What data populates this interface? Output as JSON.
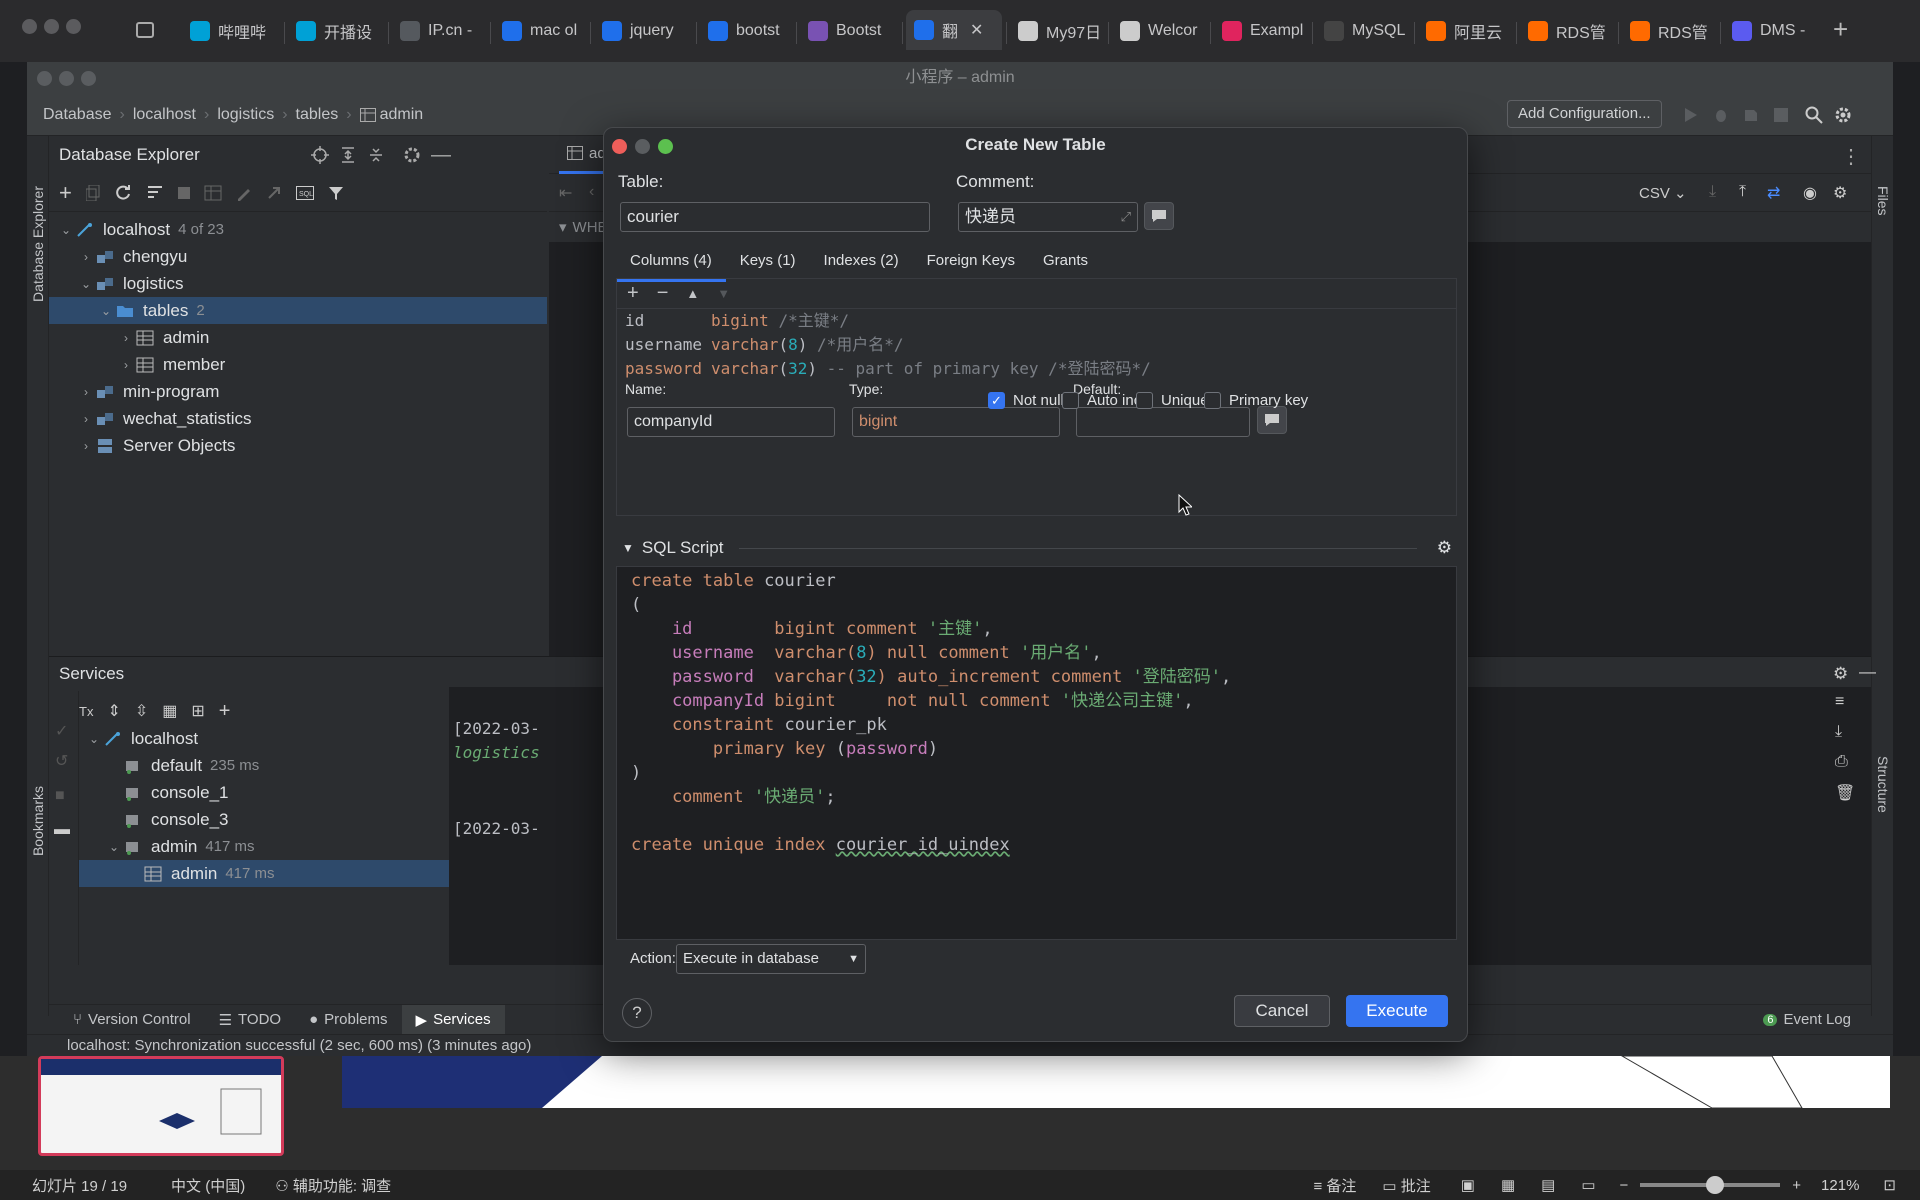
{
  "browser": {
    "tabs": [
      {
        "label": "哔哩哔",
        "fav": "bilibili-icon",
        "color": "#00a1d6"
      },
      {
        "label": "开播设",
        "fav": "bilibili-icon",
        "color": "#00a1d6"
      },
      {
        "label": "IP.cn -",
        "fav": "ip-icon",
        "color": "#55595e"
      },
      {
        "label": "mac ol",
        "fav": "bing-icon",
        "color": "#1f6feb"
      },
      {
        "label": "jquery",
        "fav": "bing-icon",
        "color": "#1f6feb"
      },
      {
        "label": "bootst",
        "fav": "bing-icon",
        "color": "#1f6feb"
      },
      {
        "label": "Bootst",
        "fav": "bootstrap-icon",
        "color": "#7952b3"
      },
      {
        "label": "翻",
        "fav": "bing-icon",
        "color": "#1f6feb",
        "active": true
      },
      {
        "label": "My97日",
        "fav": "page-icon",
        "color": "#cccccc"
      },
      {
        "label": "Welcor",
        "fav": "globe-icon",
        "color": "#cccccc"
      },
      {
        "label": "Exampl",
        "fav": "record-icon",
        "color": "#e0245e"
      },
      {
        "label": "MySQL",
        "fav": "b-icon",
        "color": "#444"
      },
      {
        "label": "阿里云",
        "fav": "aliyun-icon",
        "color": "#ff6a00"
      },
      {
        "label": "RDS管",
        "fav": "aliyun-icon",
        "color": "#ff6a00"
      },
      {
        "label": "RDS管",
        "fav": "aliyun-icon",
        "color": "#ff6a00"
      },
      {
        "label": "DMS -",
        "fav": "dms-icon",
        "color": "#5b5bf0"
      }
    ]
  },
  "ide": {
    "window_title": "小程序 – admin",
    "breadcrumb": [
      "Database",
      "localhost",
      "logistics",
      "tables",
      "admin"
    ],
    "add_configuration": "Add Configuration...",
    "left_strip_label": "Database Explorer",
    "bookmarks_label": "Bookmarks",
    "right_strip_files": "Files",
    "right_strip_structure": "Structure",
    "db_explorer": {
      "title": "Database Explorer",
      "tree": [
        {
          "label": "localhost",
          "meta": "4 of 23",
          "depth": 0,
          "arrow": "open",
          "icon": "host"
        },
        {
          "label": "chengyu",
          "depth": 1,
          "arrow": "closed",
          "icon": "schema"
        },
        {
          "label": "logistics",
          "depth": 1,
          "arrow": "open",
          "icon": "schema"
        },
        {
          "label": "tables",
          "meta": "2",
          "depth": 2,
          "arrow": "open",
          "icon": "folder",
          "selected": true
        },
        {
          "label": "admin",
          "depth": 3,
          "arrow": "closed",
          "icon": "table"
        },
        {
          "label": "member",
          "depth": 3,
          "arrow": "closed",
          "icon": "table"
        },
        {
          "label": "min-program",
          "depth": 1,
          "arrow": "closed",
          "icon": "schema"
        },
        {
          "label": "wechat_statistics",
          "depth": 1,
          "arrow": "closed",
          "icon": "schema"
        },
        {
          "label": "Server Objects",
          "depth": 1,
          "arrow": "closed",
          "icon": "server"
        }
      ]
    },
    "editor": {
      "tab": "admin",
      "where_label": "WHER",
      "csv_label": "CSV"
    },
    "services": {
      "title": "Services",
      "tree": [
        {
          "label": "localhost",
          "depth": 0,
          "arrow": "open"
        },
        {
          "label": "default",
          "meta": "235 ms",
          "depth": 1
        },
        {
          "label": "console_1",
          "depth": 1
        },
        {
          "label": "console_3",
          "depth": 1
        },
        {
          "label": "admin",
          "meta": "417 ms",
          "depth": 1,
          "arrow": "open"
        },
        {
          "label": "admin",
          "meta": "417 ms",
          "depth": 2,
          "selected": true
        }
      ],
      "console_lines": [
        "[2022-03-",
        "logistics",
        "[2022-03-"
      ]
    },
    "tool_windows": [
      "Version Control",
      "TODO",
      "Problems",
      "Services"
    ],
    "event_log": {
      "count": "6",
      "label": "Event Log"
    },
    "status": "localhost: Synchronization successful (2 sec, 600 ms) (3 minutes ago)"
  },
  "dialog": {
    "title": "Create New Table",
    "table_label": "Table:",
    "table_value": "courier",
    "comment_label": "Comment:",
    "comment_value": "快递员",
    "tabs": [
      "Columns (4)",
      "Keys (1)",
      "Indexes (2)",
      "Foreign Keys",
      "Grants"
    ],
    "columns_preview": [
      {
        "name": "id",
        "type": "bigint",
        "args": "",
        "note": "/*主键*/"
      },
      {
        "name": "username",
        "type": "varchar",
        "args": "8",
        "note": "/*用户名*/"
      },
      {
        "name": "password",
        "type": "varchar",
        "args": "32",
        "note": "-- part of primary key /*登陆密码*/"
      }
    ],
    "name_label": "Name:",
    "name_value": "companyId",
    "type_label": "Type:",
    "type_value": "bigint",
    "default_label": "Default:",
    "default_value": "",
    "checkboxes": [
      {
        "label": "Not null",
        "checked": true
      },
      {
        "label": "Auto inc",
        "checked": false
      },
      {
        "label": "Unique",
        "checked": false
      },
      {
        "label": "Primary key",
        "checked": false
      }
    ],
    "sql_script_label": "SQL Script",
    "action_label": "Action:",
    "action_value": "Execute in database",
    "cancel": "Cancel",
    "execute": "Execute"
  },
  "sql": [
    [
      [
        "create table ",
        "kw"
      ],
      [
        "courier",
        "pl"
      ]
    ],
    [
      [
        "(",
        "pl"
      ]
    ],
    [
      [
        "    id        ",
        "id"
      ],
      [
        "bigint comment ",
        "kw"
      ],
      [
        "'主键'",
        "str"
      ],
      [
        ",",
        "pl"
      ]
    ],
    [
      [
        "    username  ",
        "id"
      ],
      [
        "varchar(",
        "kw"
      ],
      [
        "8",
        "num"
      ],
      [
        ") null comment ",
        "kw"
      ],
      [
        "'用户名'",
        "str"
      ],
      [
        ",",
        "pl"
      ]
    ],
    [
      [
        "    password  ",
        "id"
      ],
      [
        "varchar(",
        "kw"
      ],
      [
        "32",
        "num"
      ],
      [
        ") auto_increment comment ",
        "kw"
      ],
      [
        "'登陆密码'",
        "str"
      ],
      [
        ",",
        "pl"
      ]
    ],
    [
      [
        "    companyId ",
        "id"
      ],
      [
        "bigint     not null comment ",
        "kw"
      ],
      [
        "'快递公司主键'",
        "str"
      ],
      [
        ",",
        "pl"
      ]
    ],
    [
      [
        "    constraint ",
        "kw"
      ],
      [
        "courier_pk",
        "pl"
      ]
    ],
    [
      [
        "        primary key ",
        "kw"
      ],
      [
        "(",
        "pl"
      ],
      [
        "password",
        "id"
      ],
      [
        ")",
        "pl"
      ]
    ],
    [
      [
        ")",
        "pl"
      ]
    ],
    [
      [
        "    comment ",
        "kw"
      ],
      [
        "'快递员'",
        "str"
      ],
      [
        ";",
        "pl"
      ]
    ],
    [
      [
        "",
        "pl"
      ]
    ],
    [
      [
        "create unique index ",
        "kw"
      ],
      [
        "courier_id_uindex",
        "pl"
      ]
    ]
  ],
  "os": {
    "slide": "幻灯片 19 / 19",
    "lang": "中文 (中国)",
    "accessibility": "辅助功能: 调查",
    "notes": "备注",
    "comments": "批注",
    "zoom": "121%"
  }
}
